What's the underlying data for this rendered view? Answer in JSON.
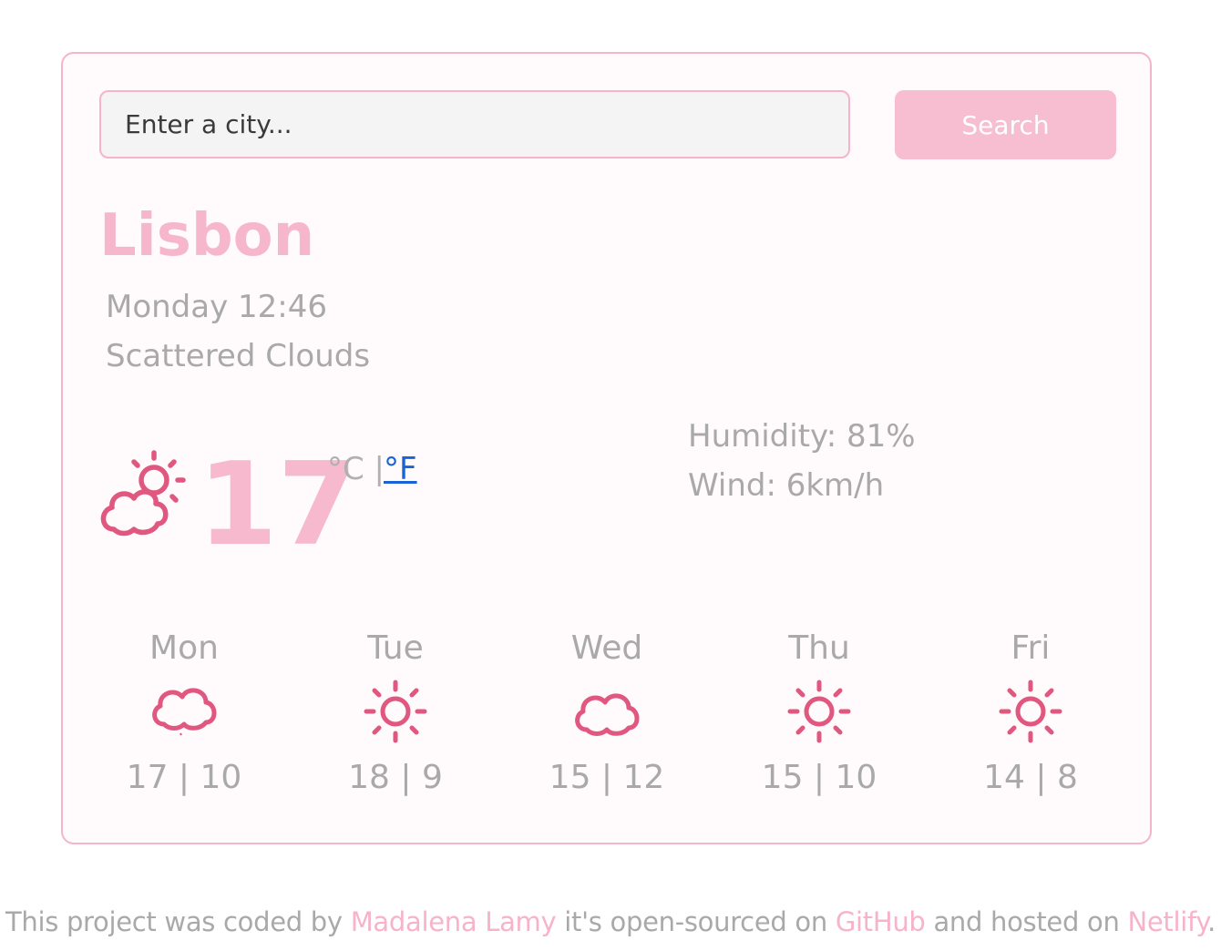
{
  "search": {
    "placeholder": "Enter a city...",
    "button_label": "Search"
  },
  "current": {
    "city": "Lisbon",
    "date": "Monday 12:46",
    "description": "Scattered Clouds",
    "icon": "partly-cloudy-icon",
    "temperature": "17",
    "unit_celsius": "°C |",
    "unit_fahrenheit": "°F",
    "humidity": "Humidity: 81%",
    "wind": "Wind: 6km/h"
  },
  "forecast": [
    {
      "day": "Mon",
      "icon": "cloud-icon",
      "temps": "17 | 10"
    },
    {
      "day": "Tue",
      "icon": "sun-icon",
      "temps": "18 | 9"
    },
    {
      "day": "Wed",
      "icon": "cloud-icon",
      "temps": "15 | 12"
    },
    {
      "day": "Thu",
      "icon": "sun-icon",
      "temps": "15 | 10"
    },
    {
      "day": "Fri",
      "icon": "sun-icon",
      "temps": "14 | 8"
    }
  ],
  "footer": {
    "text1": "This project was coded by ",
    "author": "Madalena Lamy",
    "text2": " it's open-sourced on ",
    "github": "GitHub",
    "text3": " and hosted on ",
    "netlify": "Netlify",
    "text4": "."
  },
  "colors": {
    "accent": "#f6b6cb",
    "icon_pink": "#e0577f",
    "link_blue": "#1a63d6",
    "text_gray": "#a9a9a9"
  }
}
